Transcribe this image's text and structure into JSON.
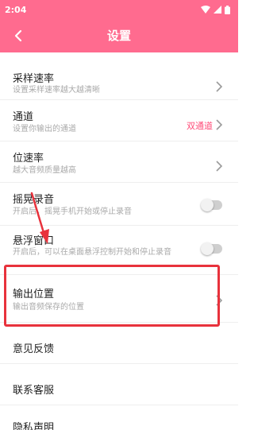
{
  "status_bar": {
    "time": "2:04"
  },
  "app_bar": {
    "title": "设置",
    "back_icon": "chevron-left-icon"
  },
  "settings": {
    "sample_rate": {
      "title": "采样速率",
      "subtitle": "设置采样速率越大越清晰"
    },
    "channel": {
      "title": "通道",
      "subtitle": "设置你输出的通道",
      "value": "双通道"
    },
    "bitrate": {
      "title": "位速率",
      "subtitle": "越大音频质量越高"
    },
    "shake_record": {
      "title": "摇晃录音",
      "subtitle": "开启后，摇晃手机开始或停止录音",
      "enabled": false
    },
    "floating_window": {
      "title": "悬浮窗口",
      "subtitle": "开启后，可以在桌面悬浮控制开始和停止录音",
      "enabled": false
    },
    "output_location": {
      "title": "输出位置",
      "subtitle": "输出音频保存的位置"
    },
    "feedback": {
      "title": "意见反馈"
    },
    "contact_support": {
      "title": "联系客服"
    },
    "privacy": {
      "title": "隐私声明"
    }
  },
  "colors": {
    "accent": "#ff6b8f",
    "value_text": "#ff4d79",
    "annotation": "#e8323c"
  }
}
